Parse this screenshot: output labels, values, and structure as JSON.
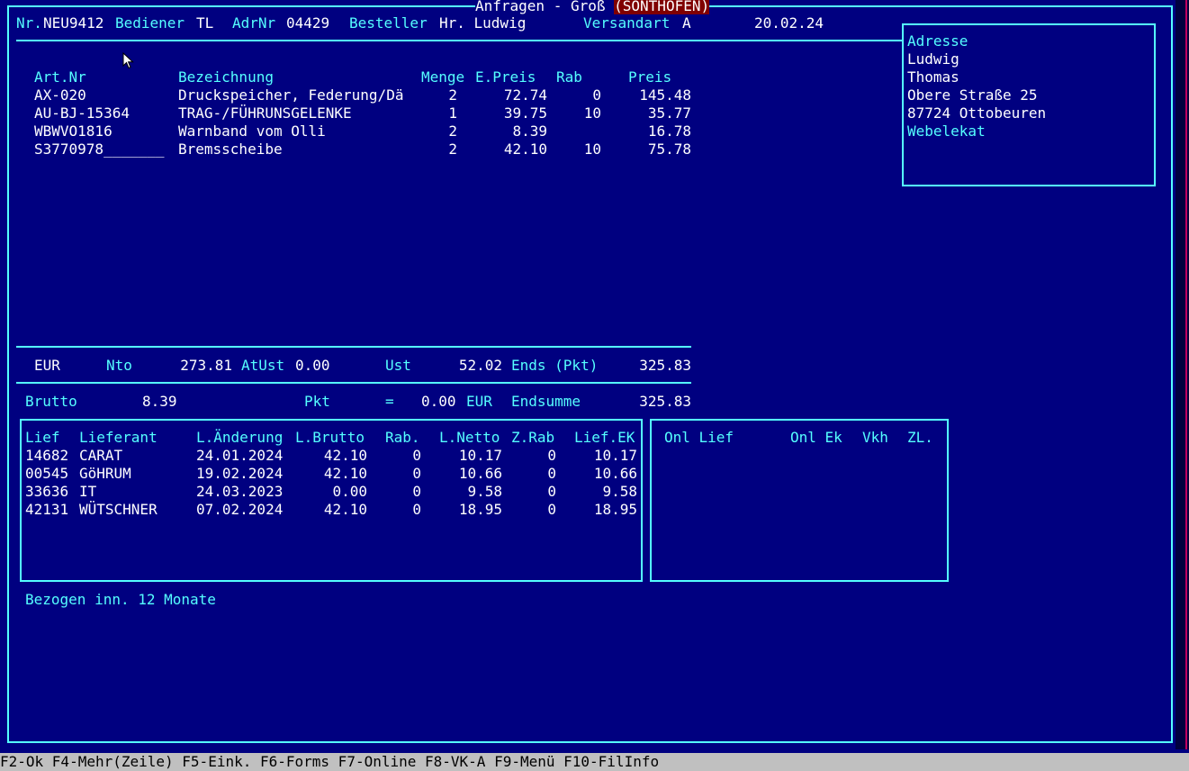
{
  "window": {
    "title": "Anfragen - Groß",
    "location": "(SONTHOFEN)"
  },
  "header": {
    "nr_label": "Nr.",
    "nr_value": "NEU9412",
    "bediener_label": "Bediener",
    "bediener_value": "TL",
    "adrnr_label": "AdrNr",
    "adrnr_value": "04429",
    "besteller_label": "Besteller",
    "besteller_value": "Hr. Ludwig",
    "versandart_label": "Versandart",
    "versandart_value": "A",
    "date": "20.02.24"
  },
  "address": {
    "heading": "Adresse",
    "lines": [
      "Ludwig",
      "Thomas",
      "Obere Straße 25",
      "87724 Ottobeuren"
    ],
    "tag": "Webelekat"
  },
  "items": {
    "headers": {
      "artnr": "Art.Nr",
      "bezeichnung": "Bezeichnung",
      "menge": "Menge",
      "epreis": "E.Preis",
      "rab": "Rab",
      "preis": "Preis"
    },
    "rows": [
      {
        "artnr": "AX-020",
        "bezeichnung": "Druckspeicher, Federung/Dä",
        "menge": "2",
        "epreis": "72.74",
        "rab": "0",
        "preis": "145.48"
      },
      {
        "artnr": "AU-BJ-15364",
        "bezeichnung": "TRAG-/FÜHRUNSGELENKE",
        "menge": "1",
        "epreis": "39.75",
        "rab": "10",
        "preis": "35.77"
      },
      {
        "artnr": "WBWVO1816",
        "bezeichnung": "Warnband vom Olli",
        "menge": "2",
        "epreis": "8.39",
        "rab": "",
        "preis": "16.78"
      },
      {
        "artnr": "S3770978_______",
        "bezeichnung": "Bremsscheibe",
        "menge": "2",
        "epreis": "42.10",
        "rab": "10",
        "preis": "75.78"
      }
    ]
  },
  "totals": {
    "currency": "EUR",
    "nto_label": "Nto",
    "nto_value": "273.81",
    "atust_label": "AtUst",
    "atust_value": "0.00",
    "ust_label": "Ust",
    "ust_value": "52.02",
    "ends_label": "Ends (Pkt)",
    "ends_value": "325.83",
    "brutto_label": "Brutto",
    "brutto_value": "8.39",
    "pkt_label": "Pkt",
    "pkt_eq": "=",
    "pkt_value": "0.00",
    "pkt_currency": "EUR",
    "endsumme_label": "Endsumme",
    "endsumme_value": "325.83"
  },
  "suppliers": {
    "headers": {
      "lief": "Lief",
      "lieferant": "Lieferant",
      "aenderung": "L.Änderung",
      "brutto": "L.Brutto",
      "rab": "Rab.",
      "netto": "L.Netto",
      "zrab": "Z.Rab",
      "liefek": "Lief.EK"
    },
    "rows": [
      {
        "lief": "14682",
        "lieferant": "CARAT",
        "aenderung": "24.01.2024",
        "brutto": "42.10",
        "rab": "0",
        "netto": "10.17",
        "zrab": "0",
        "liefek": "10.17"
      },
      {
        "lief": "00545",
        "lieferant": "GöHRUM",
        "aenderung": "19.02.2024",
        "brutto": "42.10",
        "rab": "0",
        "netto": "10.66",
        "zrab": "0",
        "liefek": "10.66"
      },
      {
        "lief": "33636",
        "lieferant": "IT",
        "aenderung": "24.03.2023",
        "brutto": "0.00",
        "rab": "0",
        "netto": "9.58",
        "zrab": "0",
        "liefek": "9.58"
      },
      {
        "lief": "42131",
        "lieferant": "WÜTSCHNER",
        "aenderung": "07.02.2024",
        "brutto": "42.10",
        "rab": "0",
        "netto": "18.95",
        "zrab": "0",
        "liefek": "18.95"
      }
    ]
  },
  "online": {
    "headers": {
      "onllief": "Onl Lief",
      "onlek": "Onl Ek",
      "vkh": "Vkh",
      "zl": "ZL."
    }
  },
  "footer_note": "Bezogen inn. 12 Monate",
  "statusbar": "F2-Ok F4-Mehr(Zeile) F5-Eink. F6-Forms F7-Online F8-VK-A F9-Menü F10-FilInfo",
  "colors": {
    "background": "#000080",
    "accent": "#55ffff",
    "text": "#ffffff",
    "location_bg": "#800000",
    "statusbar_bg": "#c0c0c0"
  }
}
